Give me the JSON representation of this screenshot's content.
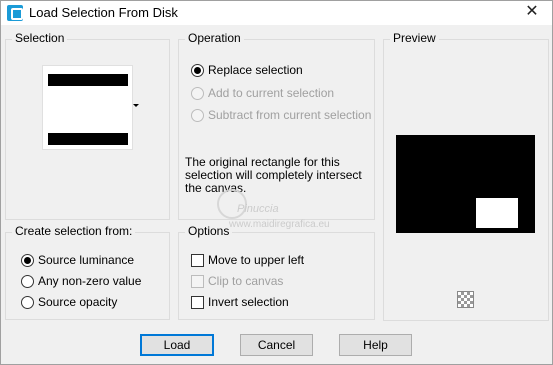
{
  "window": {
    "title": "Load Selection From Disk",
    "close_icon": "close-icon",
    "accent": "#1b9bd7"
  },
  "selection": {
    "label": "Selection",
    "thumbnail_icon": "selection-thumbnail"
  },
  "operation": {
    "label": "Operation",
    "options": [
      {
        "label": "Replace selection",
        "checked": true,
        "enabled": true
      },
      {
        "label": "Add to current selection",
        "checked": false,
        "enabled": false
      },
      {
        "label": "Subtract from current selection",
        "checked": false,
        "enabled": false
      }
    ],
    "info": "The original rectangle for this selection will completely intersect the canvas."
  },
  "preview": {
    "label": "Preview"
  },
  "create_from": {
    "label": "Create selection from:",
    "options": [
      {
        "label": "Source luminance",
        "checked": true
      },
      {
        "label": "Any non-zero value",
        "checked": false
      },
      {
        "label": "Source opacity",
        "checked": false
      }
    ]
  },
  "options": {
    "label": "Options",
    "items": [
      {
        "label": "Move to upper left",
        "checked": false,
        "enabled": true
      },
      {
        "label": "Clip to canvas",
        "checked": false,
        "enabled": false
      },
      {
        "label": "Invert selection",
        "checked": false,
        "enabled": true
      }
    ]
  },
  "buttons": {
    "load": "Load",
    "cancel": "Cancel",
    "help": "Help"
  },
  "watermark": {
    "name": "Pinuccia",
    "url": "www.maidiregrafica.eu"
  }
}
